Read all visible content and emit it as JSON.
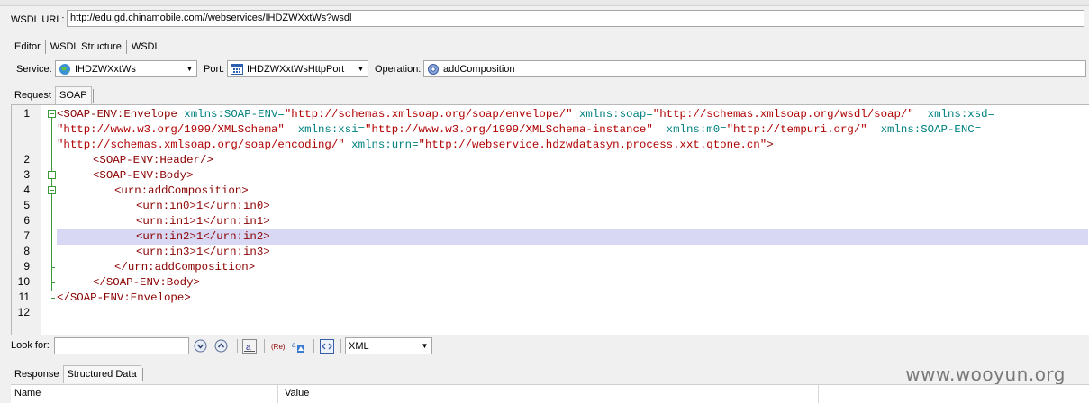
{
  "wsdl": {
    "label": "WSDL URL:",
    "url": "http://edu.gd.chinamobile.com//webservices/IHDZWXxtWs?wsdl"
  },
  "view_tabs": [
    {
      "label": "Editor",
      "active": true
    },
    {
      "label": "WSDL Structure",
      "active": false
    },
    {
      "label": "WSDL",
      "active": false
    }
  ],
  "service": {
    "service_label": "Service:",
    "service_value": "IHDZWXxtWs",
    "port_label": "Port:",
    "port_value": "IHDZWXxtWsHttpPort",
    "operation_label": "Operation:",
    "operation_value": "addComposition"
  },
  "request_tabs": [
    {
      "label": "Request",
      "active": false
    },
    {
      "label": "SOAP",
      "active": true
    }
  ],
  "editor": {
    "line_numbers": [
      "1",
      "2",
      "3",
      "4",
      "5",
      "6",
      "7",
      "8",
      "9",
      "10",
      "11",
      "12"
    ],
    "highlighted_line": 7,
    "line1": {
      "tag_open": "<SOAP-ENV:Envelope ",
      "a1": "xmlns:SOAP-ENV=",
      "v1": "\"http://schemas.xmlsoap.org/soap/envelope/\"",
      "a2": "xmlns:soap=",
      "v2": "\"http://schemas.xmlsoap.org/wsdl/soap/\"",
      "a3": "xmlns:xsd=",
      "v3": "\"http://www.w3.org/1999/XMLSchema\"",
      "a4": "xmlns:xsi=",
      "v4": "\"http://www.w3.org/1999/XMLSchema-instance\"",
      "a5": "xmlns:m0=",
      "v5": "\"http://tempuri.org/\"",
      "a6": "xmlns:SOAP-ENC=",
      "v6": "\"http://schemas.xmlsoap.org/soap/encoding/\"",
      "a7": "xmlns:urn=",
      "v7": "\"http://webservice.hdzwdatasyn.process.xxt.qtone.cn\"",
      "tag_close": ">"
    },
    "lines": [
      "<SOAP-ENV:Header/>",
      "<SOAP-ENV:Body>",
      "<urn:addComposition>",
      "<urn:in0>1</urn:in0>",
      "<urn:in1>1</urn:in1>",
      "<urn:in2>1</urn:in2>",
      "<urn:in3>1</urn:in3>",
      "</urn:addComposition>",
      "</SOAP-ENV:Body>",
      "</SOAP-ENV:Envelope>"
    ]
  },
  "lookfor": {
    "label": "Look for:",
    "value": "",
    "format_value": "XML"
  },
  "response_tabs": [
    {
      "label": "Response",
      "active": false
    },
    {
      "label": "Structured Data",
      "active": true
    }
  ],
  "table": {
    "columns": [
      "Name",
      "Value"
    ]
  },
  "watermark": "www.wooyun.org"
}
